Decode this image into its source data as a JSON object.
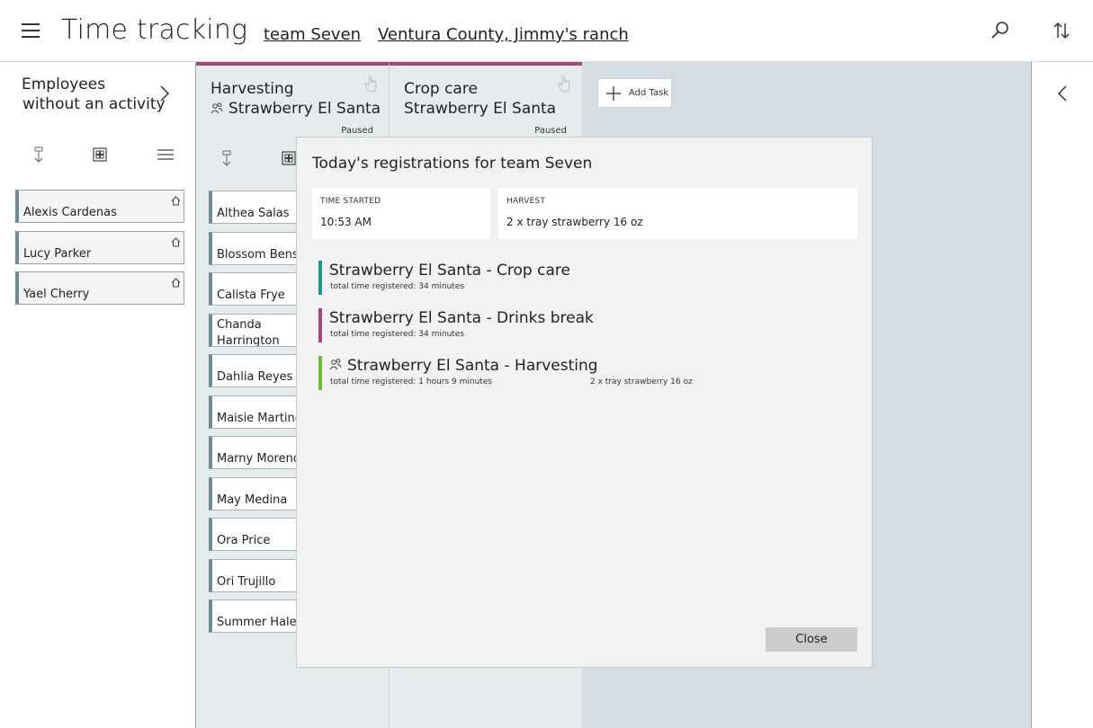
{
  "header": {
    "title": "Time tracking",
    "team_link": "team Seven",
    "location_link": "Ventura County, Jimmy's ranch",
    "icons": [
      "menu-icon",
      "search-icon",
      "sort-icon"
    ]
  },
  "left_panel": {
    "title_line1": "Employees",
    "title_line2": "without an activity",
    "employees": [
      {
        "name": "Alexis Cardenas"
      },
      {
        "name": "Lucy Parker"
      },
      {
        "name": "Yael Cherry"
      }
    ]
  },
  "columns": [
    {
      "title": "Harvesting",
      "subtitle": "Strawberry El Santa",
      "status": "Paused",
      "employees": [
        "Althea Salas",
        "Blossom Benson",
        "Calista Frye",
        "Chanda Harrington Compostella",
        "Dahlia Reyes",
        "Maisie Martinez",
        "Marny Moreno",
        "May Medina",
        "Ora Price",
        "Ori Trujillo",
        "Summer Hale"
      ]
    },
    {
      "title": "Crop care",
      "subtitle": "Strawberry El Santa",
      "status": "Paused"
    }
  ],
  "add_task_label": "Add Task",
  "dialog": {
    "title": "Today's registrations for team Seven",
    "time_started_label": "TIME STARTED",
    "time_started_value": "10:53 AM",
    "harvest_label": "HARVEST",
    "harvest_value": "2 x tray strawberry 16 oz",
    "registrations": [
      {
        "title": "Strawberry El Santa  -  Crop care",
        "sub": "total time registered: 34 minutes",
        "note": "",
        "color": "#1a9a8a"
      },
      {
        "title": "Strawberry El Santa  -  Drinks break",
        "sub": "total time registered: 34 minutes",
        "note": "",
        "color": "#a3477a"
      },
      {
        "title": "Strawberry El Santa  -  Harvesting",
        "sub": "total time registered: 1 hours 9 minutes",
        "note": "2 x tray strawberry 16 oz",
        "color": "#6cbf2e"
      }
    ],
    "close_label": "Close"
  },
  "colors": {
    "accent_column": "#a3477a",
    "card_stripe": "#6d8c94",
    "board_bg": "#d5dde2"
  }
}
